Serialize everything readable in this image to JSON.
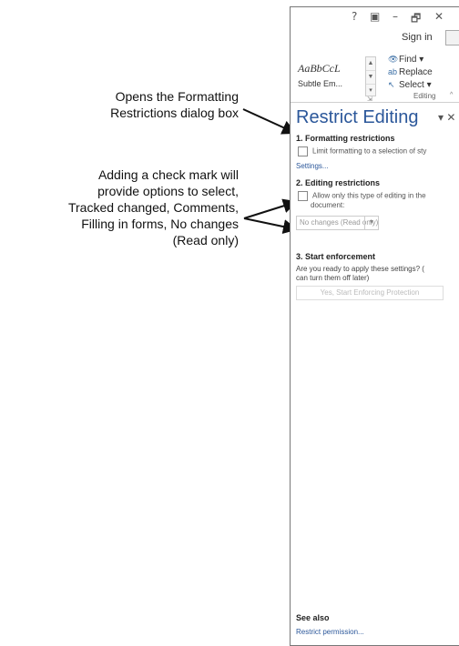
{
  "callouts": {
    "first": [
      "Opens the Formatting",
      "Restrictions dialog box"
    ],
    "second": [
      "Adding a check mark will",
      "provide options to select,",
      "Tracked changed, Comments,",
      "Filling in forms, No changes",
      "(Read only)"
    ]
  },
  "window": {
    "title_icons": [
      "?",
      "▣",
      "–",
      "🗗",
      "✕"
    ],
    "sign_in": "Sign in"
  },
  "ribbon": {
    "styles": [
      "AaBbCcL",
      "Subtle Em..."
    ],
    "editing": {
      "find": "Find",
      "replace": "Replace",
      "select": "Select",
      "group_label": "Editing"
    }
  },
  "pane": {
    "title": "Restrict Editing",
    "sections": {
      "formatting": {
        "heading": "1. Formatting restrictions",
        "checkbox_label": "Limit formatting to a selection of sty",
        "settings_link": "Settings..."
      },
      "editing": {
        "heading": "2. Editing restrictions",
        "checkbox_label_line1": "Allow only this type of editing in the",
        "checkbox_label_line2": "document:",
        "select_value": "No changes (Read only)"
      },
      "enforcement": {
        "heading": "3. Start enforcement",
        "text_line1": "Are you ready to apply these settings? (",
        "text_line2": "can turn them off later)",
        "button": "Yes, Start Enforcing Protection"
      }
    },
    "see_also": {
      "heading": "See also",
      "link": "Restrict permission..."
    }
  },
  "colors": {
    "pane_title": "#2b579a",
    "link": "#2b579a"
  }
}
